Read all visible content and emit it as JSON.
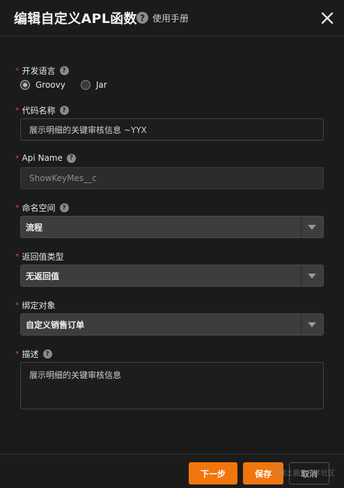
{
  "dialog": {
    "title": "编辑自定义APL函数",
    "help_link": "使用手册"
  },
  "form": {
    "language": {
      "label": "开发语言",
      "options": [
        "Groovy",
        "Jar"
      ],
      "selected": "Groovy"
    },
    "code_name": {
      "label": "代码名称",
      "value": "展示明细的关键审核信息 ~YYX"
    },
    "api_name": {
      "label": "Api Name",
      "value": "ShowKeyMes__c"
    },
    "namespace": {
      "label": "命名空间",
      "value": "流程"
    },
    "return_type": {
      "label": "返回值类型",
      "value": "无返回值"
    },
    "bound_object": {
      "label": "绑定对象",
      "value": "自定义销售订单"
    },
    "description": {
      "label": "描述",
      "value": "展示明细的关键审核信息"
    }
  },
  "footer": {
    "next_label": "下一步",
    "save_label": "保存",
    "cancel_label": "取消"
  },
  "watermark": "@稀土掘金技术社区",
  "colors": {
    "background": "#1b1b1b",
    "primary": "#f0760e",
    "required": "#e0442f"
  }
}
